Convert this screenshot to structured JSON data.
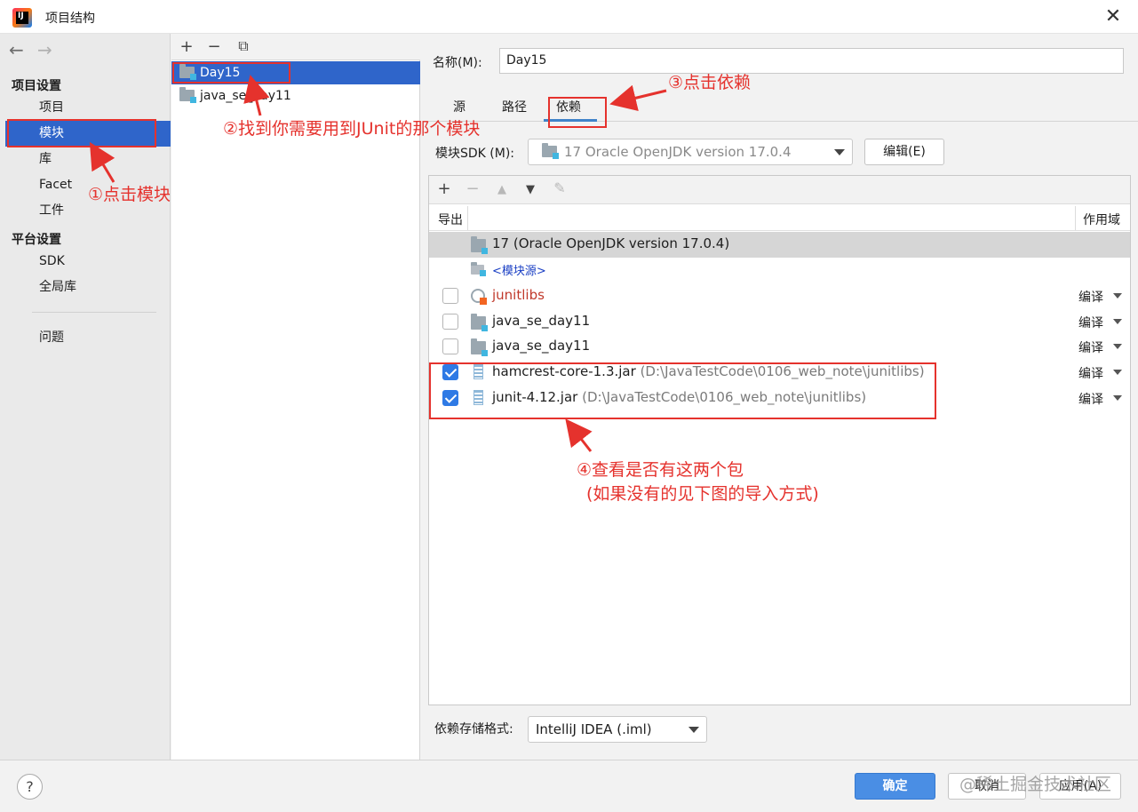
{
  "window": {
    "title": "项目结构",
    "close_glyph": "✕"
  },
  "nav": {
    "back_glyph": "←",
    "forward_glyph": "→",
    "project_settings_heading": "项目设置",
    "project_items": [
      "项目",
      "模块",
      "库",
      "Facet",
      "工件"
    ],
    "platform_settings_heading": "平台设置",
    "platform_items": [
      "SDK",
      "全局库"
    ],
    "problems": "问题",
    "selected": "模块"
  },
  "module_toolbar": {
    "add": "+",
    "remove": "−",
    "copy": "⧉"
  },
  "modules": [
    {
      "name": "Day15",
      "selected": true
    },
    {
      "name": "java_se_day11",
      "selected": false
    }
  ],
  "right": {
    "name_label": "名称(M):",
    "name_value": "Day15",
    "tabs": [
      "源",
      "路径",
      "依赖"
    ],
    "active_tab": "依赖",
    "sdk_label": "模块SDK (M):",
    "sdk_value": "17 Oracle OpenJDK version 17.0.4",
    "edit_button": "编辑(E)",
    "dep_toolbar": {
      "add": "+",
      "remove": "−",
      "up": "▲",
      "down": "▼",
      "edit": "✎"
    },
    "columns": {
      "export": "导出",
      "scope": "作用域"
    },
    "dependencies": [
      {
        "kind": "sdk",
        "text": "17 (Oracle OpenJDK version 17.0.4)",
        "path": "",
        "checkbox": false,
        "checked": false,
        "scope": "",
        "color": "#1e1e1e"
      },
      {
        "kind": "source",
        "text": "<模块源>",
        "path": "",
        "checkbox": false,
        "checked": false,
        "scope": "",
        "color": "#1a3fc4"
      },
      {
        "kind": "library",
        "text": "junitlibs",
        "path": "",
        "checkbox": true,
        "checked": false,
        "scope": "编译",
        "color": "#c0392b"
      },
      {
        "kind": "module",
        "text": "java_se_day11",
        "path": "",
        "checkbox": true,
        "checked": false,
        "scope": "编译",
        "color": "#1e1e1e"
      },
      {
        "kind": "module",
        "text": "java_se_day11",
        "path": "",
        "checkbox": true,
        "checked": false,
        "scope": "编译",
        "color": "#1e1e1e"
      },
      {
        "kind": "jar",
        "text": "hamcrest-core-1.3.jar",
        "path": "(D:\\JavaTestCode\\0106_web_note\\junitlibs)",
        "checkbox": true,
        "checked": true,
        "scope": "编译",
        "color": "#1e1e1e"
      },
      {
        "kind": "jar",
        "text": "junit-4.12.jar",
        "path": "(D:\\JavaTestCode\\0106_web_note\\junitlibs)",
        "checkbox": true,
        "checked": true,
        "scope": "编译",
        "color": "#1e1e1e"
      }
    ],
    "storage_label": "依赖存储格式:",
    "storage_value": "IntelliJ IDEA (.iml)"
  },
  "footer": {
    "help": "?",
    "ok": "确定",
    "cancel": "取消",
    "apply": "应用(A)"
  },
  "annotations": {
    "step1": "①点击模块",
    "step2": "②找到你需要用到JUnit的那个模块",
    "step3": "③点击依赖",
    "step4_line1": "④查看是否有这两个包",
    "step4_line2": "(如果没有的见下图的导入方式)",
    "color": "#e5322d"
  },
  "watermark": "@稀土掘金技术社区"
}
